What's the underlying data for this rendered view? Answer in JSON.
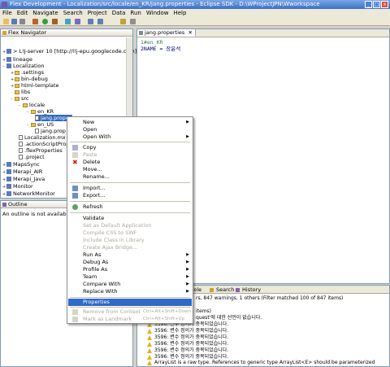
{
  "window": {
    "title": "Flex Development - Localization/src/locale/en_KR/jang.properties - Eclipse SDK - D:\\WProjectJPN\\Wworkspace"
  },
  "menu": [
    "File",
    "Edit",
    "Navigate",
    "Search",
    "Project",
    "Data",
    "Run",
    "Window",
    "Help"
  ],
  "navigator": {
    "title": "Flex Navigator",
    "items": [
      "> L!J-server 10 [http://l!j-epu.googlecode.com]",
      "lineage",
      "Localization",
      ".settings",
      "bin-debug",
      "html-template",
      "libs",
      "src",
      "locale",
      "en_KR",
      "jang.properties",
      "en_US",
      "jang.prop",
      "Localization.mx",
      ".actionScriptPropert",
      ".flexProperties",
      ".project",
      "MapsSync",
      "Merapi_AIR",
      "Merapi_Java",
      "Monitor",
      "NetworkMonitor"
    ]
  },
  "outline": {
    "title": "Outline",
    "message": "An outline is not available."
  },
  "editor": {
    "tab": "jang.properties",
    "lines": [
      "1#en_KR",
      "2NAME = 장윤석"
    ]
  },
  "bottom": {
    "tabs": [
      "sole",
      "Search",
      "History"
    ],
    "summary": "rs, 847 warnings, 1 others (Filter matched 100 of 847 items)",
    "problems": [
      "items)",
      "quest'에 대한 선언이 없습니다.",
      "3596: 변수 정의가 중복되었습니다.",
      "3596: 변수 정의가 중복되었습니다.",
      "3596: 변수 정의가 중복되었습니다.",
      "3596: 변수 정의가 중복되었습니다.",
      "3596: 변수 정의가 중복되었습니다.",
      "3596: 변수 정의가 중복되었습니다.",
      "ArrayList is a raw type. References to generic type ArrayList<E> should be parameterized",
      "ArrayList is a raw type. References to generic type ArrayList<E> should be parameterized"
    ]
  },
  "context_menu": {
    "new": "New",
    "open": "Open",
    "open_with": "Open With",
    "copy": "Copy",
    "paste": "Paste",
    "delete": "Delete",
    "move": "Move...",
    "rename": "Rename...",
    "import": "Import...",
    "export": "Export...",
    "refresh": "Refresh",
    "validate": "Validate",
    "set_default": "Set as Default Application",
    "compile_css": "Compile CSS to SWF",
    "include_class": "Include Class in Library",
    "create_ajax": "Create Ajax Bridge...",
    "run_as": "Run As",
    "debug_as": "Debug As",
    "profile_as": "Profile As",
    "team": "Team",
    "compare_with": "Compare With",
    "replace_with": "Replace With",
    "properties": "Properties",
    "remove_context": "Remove from Context",
    "remove_context_key": "Ctrl+Alt+Shift+Down",
    "mark_landmark": "Mark as Landmark",
    "mark_landmark_key": "Ctrl+Alt+Shift+Up"
  }
}
